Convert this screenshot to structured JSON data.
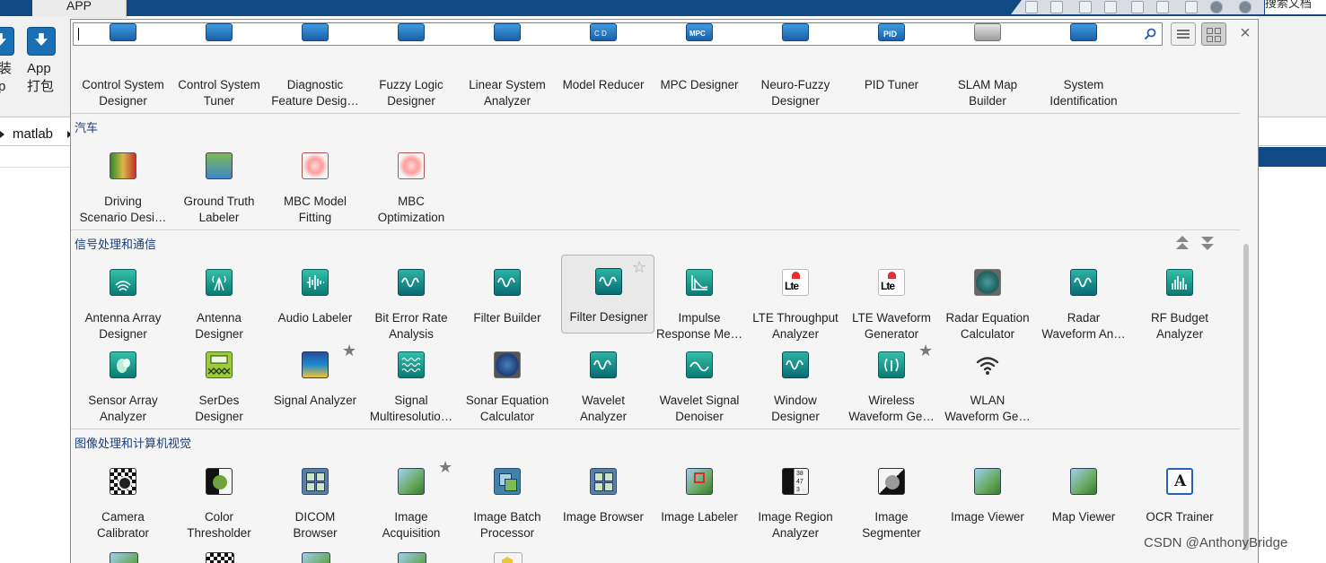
{
  "window": {
    "app_tab": "APP",
    "search_docs_placeholder": "搜索文档",
    "ribbon": {
      "left_label_line1": "装",
      "left_label_line2": "p",
      "package_app_line1": "App",
      "package_app_line2": "打包"
    },
    "path": "matlab"
  },
  "gallery": {
    "search_value": "",
    "close_label": "×",
    "sections": [
      {
        "title": "",
        "apps": [
          {
            "name": "Control System Designer",
            "line1": "Control System",
            "line2": "Designer"
          },
          {
            "name": "Control System Tuner",
            "line1": "Control System",
            "line2": "Tuner"
          },
          {
            "name": "Diagnostic Feature Designer",
            "line1": "Diagnostic",
            "line2": "Feature Desig…"
          },
          {
            "name": "Fuzzy Logic Designer",
            "line1": "Fuzzy Logic",
            "line2": "Designer"
          },
          {
            "name": "Linear System Analyzer",
            "line1": "Linear System",
            "line2": "Analyzer"
          },
          {
            "name": "Model Reducer",
            "line1": "Model Reducer",
            "line2": ""
          },
          {
            "name": "MPC Designer",
            "line1": "MPC Designer",
            "line2": ""
          },
          {
            "name": "Neuro-Fuzzy Designer",
            "line1": "Neuro-Fuzzy",
            "line2": "Designer"
          },
          {
            "name": "PID Tuner",
            "line1": "PID Tuner",
            "line2": ""
          },
          {
            "name": "SLAM Map Builder",
            "line1": "SLAM Map",
            "line2": "Builder"
          },
          {
            "name": "System Identification",
            "line1": "System",
            "line2": "Identification"
          }
        ]
      },
      {
        "title": "汽车",
        "apps": [
          {
            "name": "Driving Scenario Designer",
            "line1": "Driving",
            "line2": "Scenario Desi…"
          },
          {
            "name": "Ground Truth Labeler",
            "line1": "Ground Truth",
            "line2": "Labeler"
          },
          {
            "name": "MBC Model Fitting",
            "line1": "MBC Model",
            "line2": "Fitting"
          },
          {
            "name": "MBC Optimization",
            "line1": "MBC",
            "line2": "Optimization"
          }
        ]
      },
      {
        "title": "信号处理和通信",
        "apps": [
          {
            "name": "Antenna Array Designer",
            "line1": "Antenna Array",
            "line2": "Designer"
          },
          {
            "name": "Antenna Designer",
            "line1": "Antenna",
            "line2": "Designer"
          },
          {
            "name": "Audio Labeler",
            "line1": "Audio Labeler",
            "line2": ""
          },
          {
            "name": "Bit Error Rate Analysis",
            "line1": "Bit Error Rate",
            "line2": "Analysis"
          },
          {
            "name": "Filter Builder",
            "line1": "Filter Builder",
            "line2": ""
          },
          {
            "name": "Filter Designer",
            "line1": "Filter Designer",
            "line2": ""
          },
          {
            "name": "Impulse Response Measurer",
            "line1": "Impulse",
            "line2": "Response Me…"
          },
          {
            "name": "LTE Throughput Analyzer",
            "line1": "LTE Throughput",
            "line2": "Analyzer"
          },
          {
            "name": "LTE Waveform Generator",
            "line1": "LTE Waveform",
            "line2": "Generator"
          },
          {
            "name": "Radar Equation Calculator",
            "line1": "Radar Equation",
            "line2": "Calculator"
          },
          {
            "name": "Radar Waveform Analyzer",
            "line1": "Radar",
            "line2": "Waveform An…"
          },
          {
            "name": "RF Budget Analyzer",
            "line1": "RF Budget",
            "line2": "Analyzer"
          },
          {
            "name": "Sensor Array Analyzer",
            "line1": "Sensor Array",
            "line2": "Analyzer"
          },
          {
            "name": "SerDes Designer",
            "line1": "SerDes",
            "line2": "Designer"
          },
          {
            "name": "Signal Analyzer",
            "line1": "Signal Analyzer",
            "line2": ""
          },
          {
            "name": "Signal Multiresolution Analyzer",
            "line1": "Signal",
            "line2": "Multiresolutio…"
          },
          {
            "name": "Sonar Equation Calculator",
            "line1": "Sonar Equation",
            "line2": "Calculator"
          },
          {
            "name": "Wavelet Analyzer",
            "line1": "Wavelet",
            "line2": "Analyzer"
          },
          {
            "name": "Wavelet Signal Denoiser",
            "line1": "Wavelet Signal",
            "line2": "Denoiser"
          },
          {
            "name": "Window Designer",
            "line1": "Window",
            "line2": "Designer"
          },
          {
            "name": "Wireless Waveform Generator",
            "line1": "Wireless",
            "line2": "Waveform Ge…"
          },
          {
            "name": "WLAN Waveform Generator",
            "line1": "WLAN",
            "line2": "Waveform Ge…"
          }
        ]
      },
      {
        "title": "图像处理和计算机视觉",
        "apps": [
          {
            "name": "Camera Calibrator",
            "line1": "Camera",
            "line2": "Calibrator"
          },
          {
            "name": "Color Thresholder",
            "line1": "Color",
            "line2": "Thresholder"
          },
          {
            "name": "DICOM Browser",
            "line1": "DICOM",
            "line2": "Browser"
          },
          {
            "name": "Image Acquisition",
            "line1": "Image",
            "line2": "Acquisition"
          },
          {
            "name": "Image Batch Processor",
            "line1": "Image Batch",
            "line2": "Processor"
          },
          {
            "name": "Image Browser",
            "line1": "Image Browser",
            "line2": ""
          },
          {
            "name": "Image Labeler",
            "line1": "Image Labeler",
            "line2": ""
          },
          {
            "name": "Image Region Analyzer",
            "line1": "Image Region",
            "line2": "Analyzer"
          },
          {
            "name": "Image Segmenter",
            "line1": "Image",
            "line2": "Segmenter"
          },
          {
            "name": "Image Viewer",
            "line1": "Image Viewer",
            "line2": ""
          },
          {
            "name": "Map Viewer",
            "line1": "Map Viewer",
            "line2": ""
          },
          {
            "name": "OCR Trainer",
            "line1": "OCR Trainer",
            "line2": ""
          }
        ]
      }
    ],
    "icon_text": {
      "model_reducer": "C D",
      "mpc": "MPC",
      "pid": "PID",
      "lte": "Lte",
      "ocr": "A",
      "region_nums": "38 47 3"
    }
  },
  "watermark": "CSDN @AnthonyBridge",
  "colors": {
    "title_bar": "#0f4a84",
    "section_title": "#1a3e7a",
    "selected_tile": "#e9e9e9"
  }
}
